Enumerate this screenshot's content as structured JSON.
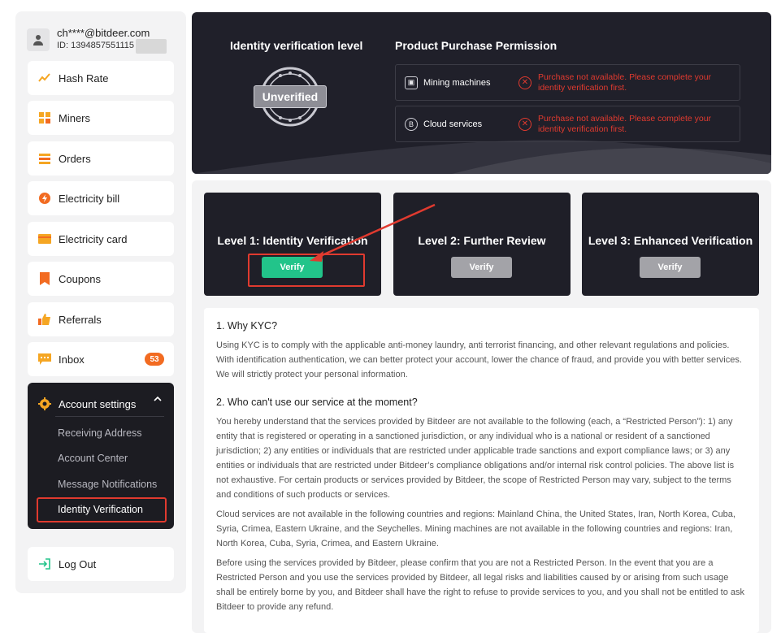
{
  "user": {
    "email": "ch****@bitdeer.com",
    "id_prefix": "ID: 1394857551115"
  },
  "sidebar": {
    "items": [
      {
        "label": "Hash Rate",
        "icon": "hash-rate-icon"
      },
      {
        "label": "Miners",
        "icon": "miners-icon"
      },
      {
        "label": "Orders",
        "icon": "orders-icon"
      },
      {
        "label": "Electricity bill",
        "icon": "electricity-bill-icon"
      },
      {
        "label": "Electricity card",
        "icon": "electricity-card-icon"
      },
      {
        "label": "Coupons",
        "icon": "coupons-icon"
      },
      {
        "label": "Referrals",
        "icon": "referrals-icon"
      },
      {
        "label": "Inbox",
        "icon": "inbox-icon",
        "badge": "53"
      }
    ],
    "account_settings": {
      "label": "Account settings",
      "sub_items": [
        "Receiving Address",
        "Account Center",
        "Message Notifications",
        "Identity Verification"
      ]
    },
    "logout": "Log Out"
  },
  "banner": {
    "level_title": "Identity verification level",
    "status": "Unverified",
    "perm_title": "Product Purchase Permission",
    "permissions": [
      {
        "name": "Mining machines",
        "message": "Purchase not available. Please complete your identity verification first."
      },
      {
        "name": "Cloud services",
        "message": "Purchase not available. Please complete your identity verification first."
      }
    ]
  },
  "levels": [
    {
      "title": "Level 1: Identity Verification",
      "button": "Verify",
      "active": true
    },
    {
      "title": "Level 2: Further Review",
      "button": "Verify",
      "active": false
    },
    {
      "title": "Level 3: Enhanced Verification",
      "button": "Verify",
      "active": false
    }
  ],
  "content": {
    "q1": "1. Why KYC?",
    "p1": "Using KYC is to comply with the applicable anti-money laundry, anti terrorist financing, and other relevant regulations and policies. With identification authentication, we can better protect your account, lower the chance of fraud, and provide you with better services. We will strictly protect your personal information.",
    "q2": "2. Who can't use our service at the moment?",
    "p2": "You hereby understand that the services provided by Bitdeer are not available to the following (each, a “Restricted Person”): 1) any entity that is registered or operating in a sanctioned jurisdiction, or any individual who is a national or resident of a sanctioned jurisdiction; 2) any entities or individuals that are restricted under applicable trade sanctions and export compliance laws; or 3) any entities or individuals that are restricted under Bitdeer’s compliance obligations and/or internal risk control policies. The above list is not exhaustive. For certain products or services provided by Bitdeer, the scope of Restricted Person may vary, subject to the terms and conditions of such products or services.",
    "p3": "Cloud services are not available in the following countries and regions: Mainland China, the United States, Iran, North Korea, Cuba, Syria, Crimea, Eastern Ukraine, and the Seychelles. Mining machines are not available in the following countries and regions: Iran, North Korea, Cuba, Syria, Crimea, and Eastern Ukraine.",
    "p4": "Before using the services provided by Bitdeer, please confirm that you are not a Restricted Person. In the event that you are a Restricted Person and you use the services provided by Bitdeer, all legal risks and liabilities caused by or arising from such usage shall be entirely borne by you, and Bitdeer shall have the right to refuse to provide services to you, and you shall not be entitled to ask Bitdeer to provide any refund."
  },
  "colors": {
    "accent_green": "#22c48a",
    "alert_red": "#e03a2f",
    "dark_panel": "#20202a",
    "badge_orange": "#f26b21"
  }
}
